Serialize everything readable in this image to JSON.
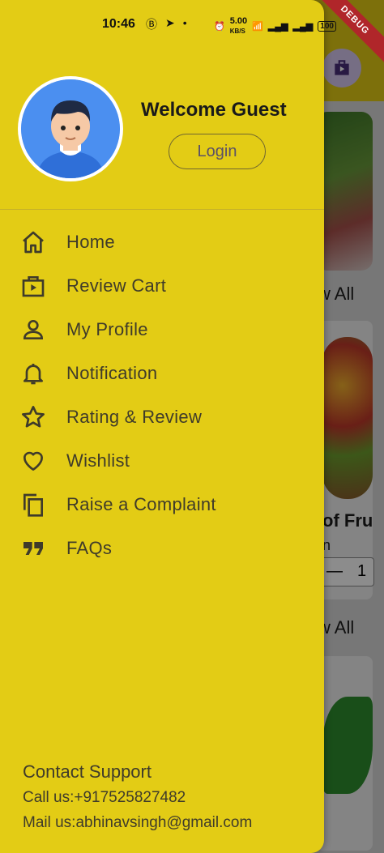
{
  "status_bar": {
    "time": "10:46",
    "net_speed": "5.00",
    "net_unit": "KB/S",
    "battery": "100"
  },
  "debug_label": "DEBUG",
  "drawer": {
    "welcome": "Welcome Guest",
    "login_label": "Login",
    "menu": [
      {
        "label": "Home",
        "icon": "home-icon"
      },
      {
        "label": "Review Cart",
        "icon": "cart-icon"
      },
      {
        "label": "My Profile",
        "icon": "person-icon"
      },
      {
        "label": "Notification",
        "icon": "bell-icon"
      },
      {
        "label": "Rating & Review",
        "icon": "star-icon"
      },
      {
        "label": "Wishlist",
        "icon": "heart-icon"
      },
      {
        "label": "Raise a Complaint",
        "icon": "copy-icon"
      },
      {
        "label": "FAQs",
        "icon": "quote-icon"
      }
    ],
    "contact_title": "Contact Support",
    "contact_phone": "Call us:+917525827482",
    "contact_mail": "Mail us:abhinavsingh@gmail.com"
  },
  "background": {
    "view_all_1": "w All",
    "product_title": "of Fru",
    "product_sub": "n",
    "stepper_value": "1",
    "view_all_2": "w All"
  },
  "colors": {
    "drawer": "#e3cc15",
    "text": "#3f3b2a",
    "accent": "#5b5166"
  }
}
